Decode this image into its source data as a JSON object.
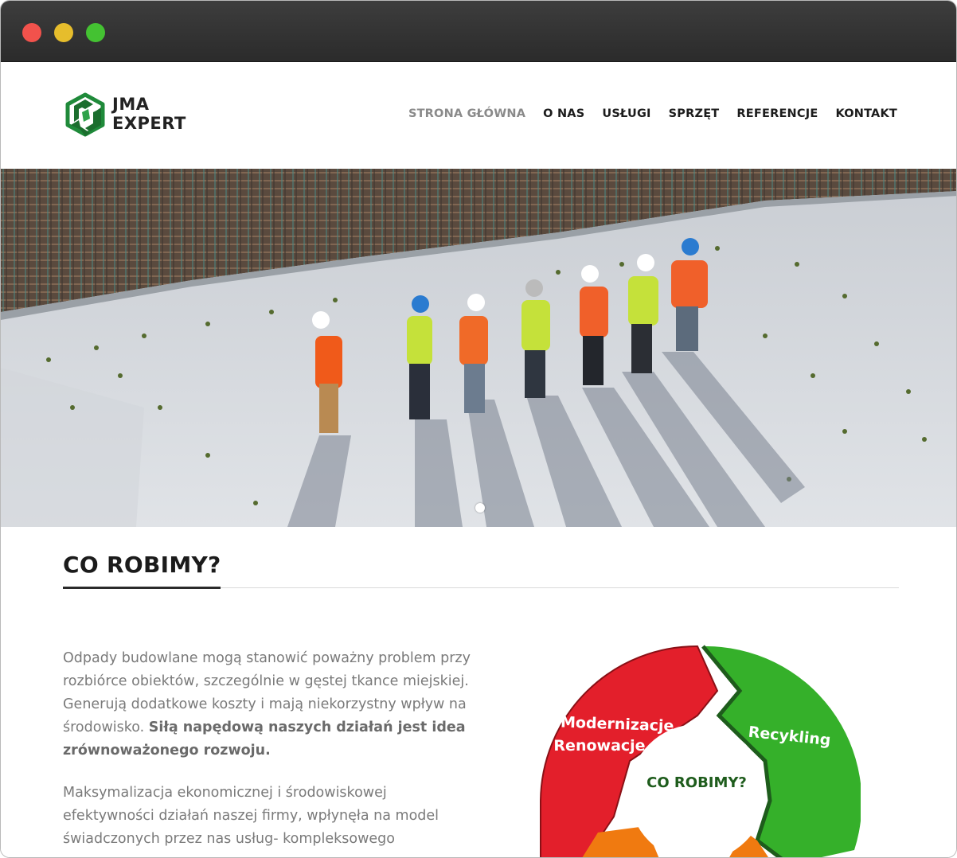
{
  "window": {
    "controls": [
      "close",
      "minimize",
      "maximize"
    ]
  },
  "brand": {
    "line1": "JMA",
    "line2": "EXPERT",
    "icon": "jma-logo-icon"
  },
  "nav": {
    "items": [
      {
        "label": "STRONA GŁÓWNA",
        "active": true
      },
      {
        "label": "O NAS",
        "active": false
      },
      {
        "label": "USŁUGI",
        "active": false
      },
      {
        "label": "SPRZĘT",
        "active": false
      },
      {
        "label": "REFERENCJE",
        "active": false
      },
      {
        "label": "KONTAKT",
        "active": false
      }
    ]
  },
  "hero": {
    "slide_count": 1,
    "current_slide": 1
  },
  "section": {
    "title": "CO ROBIMY?"
  },
  "content": {
    "p1_text": "Odpady budowlane mogą stanowić poważny problem przy rozbiórce obiektów, szczególnie w gęstej tkance miejskiej. Generują dodatkowe koszty i mają niekorzystny wpływ na środowisko. ",
    "p1_bold": "Siłą napędową naszych działań jest idea zrównoważonego rozwoju.",
    "p2_text": "Maksymalizacja ekonomicznej i środowiskowej efektywności działań naszej firmy, wpłynęła na model świadczonych przez nas usług- kompleksowego"
  },
  "diagram": {
    "center": "CO ROBIMY?",
    "seg1_line1": "Modernizacje",
    "seg1_line2": "Renowacje",
    "seg2": "Recykling",
    "colors": {
      "red": "#e31f2b",
      "green": "#35b02a",
      "orange": "#f07a10",
      "dark_green": "#1e5c1c"
    }
  },
  "colors": {
    "brand_green": "#1f8a3a",
    "brand_dark": "#222222",
    "nav_active": "#8a8a8a"
  }
}
